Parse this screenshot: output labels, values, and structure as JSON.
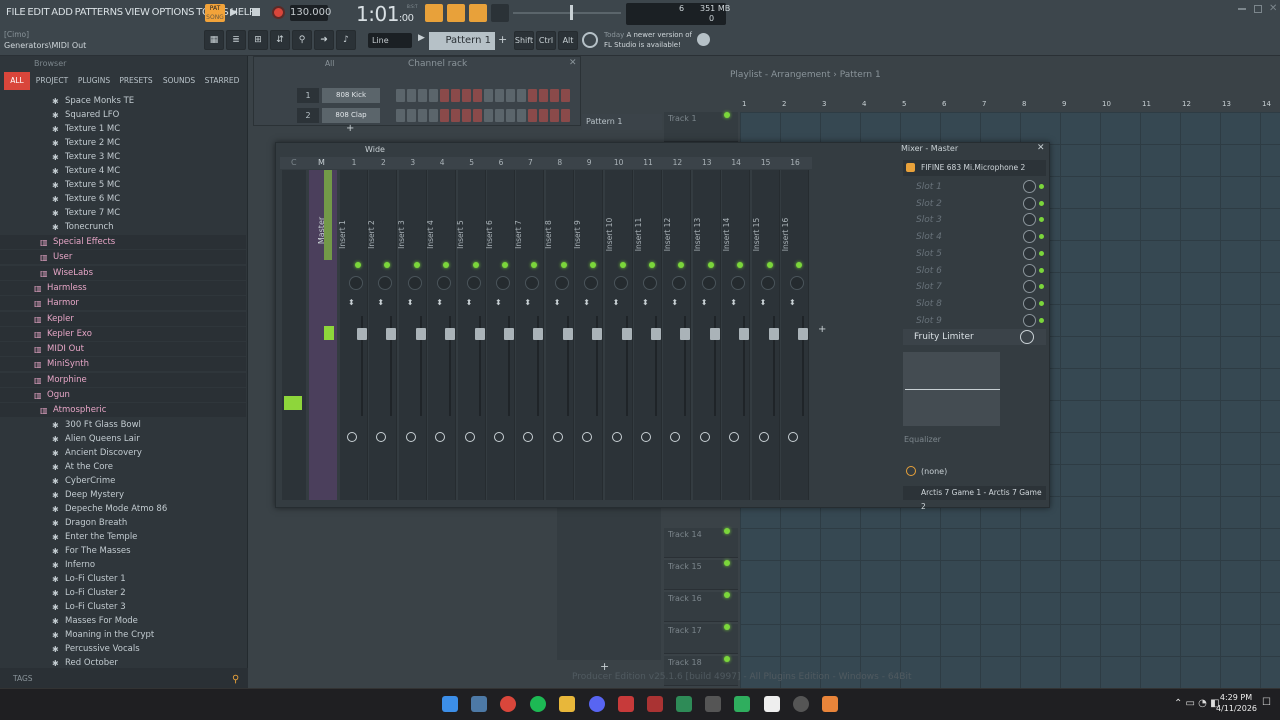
{
  "menu": [
    "FILE",
    "EDIT",
    "ADD",
    "PATTERNS",
    "VIEW",
    "OPTIONS",
    "TOOLS",
    "HELP"
  ],
  "transport": {
    "pat_label": "PAT",
    "song_label": "SONG",
    "tempo": "130.000",
    "time": "1:01",
    "time_small": ":00",
    "bst": "B:S:T"
  },
  "cpu": {
    "value": "6",
    "mem": "351 MB",
    "voices": "0"
  },
  "hint": {
    "line1": "[Cimo]",
    "line2": "Generators\\MIDI Out"
  },
  "toolbar": {
    "line": "Line",
    "pattern": "Pattern 1",
    "shift": "Shift",
    "ctrl": "Ctrl",
    "alt": "Alt"
  },
  "news": {
    "today": "Today",
    "line1": "A newer version of",
    "line2": "FL Studio is available!"
  },
  "browser": {
    "title": "Browser",
    "tabs": [
      "ALL",
      "PROJECT",
      "PLUGINS",
      "PRESETS",
      "SOUNDS",
      "STARRED"
    ],
    "items": [
      {
        "label": "Space Monks TE",
        "type": "preset"
      },
      {
        "label": "Squared LFO",
        "type": "preset"
      },
      {
        "label": "Texture 1 MC",
        "type": "preset"
      },
      {
        "label": "Texture 2 MC",
        "type": "preset"
      },
      {
        "label": "Texture 3 MC",
        "type": "preset"
      },
      {
        "label": "Texture 4 MC",
        "type": "preset"
      },
      {
        "label": "Texture 5 MC",
        "type": "preset"
      },
      {
        "label": "Texture 6 MC",
        "type": "preset"
      },
      {
        "label": "Texture 7 MC",
        "type": "preset"
      },
      {
        "label": "Tonecrunch",
        "type": "preset"
      },
      {
        "label": "Special Effects",
        "type": "folder"
      },
      {
        "label": "User",
        "type": "folder"
      },
      {
        "label": "WiseLabs",
        "type": "folder"
      },
      {
        "label": "Harmless",
        "type": "folder"
      },
      {
        "label": "Harmor",
        "type": "folder"
      },
      {
        "label": "Kepler",
        "type": "folder"
      },
      {
        "label": "Kepler Exo",
        "type": "folder"
      },
      {
        "label": "MIDI Out",
        "type": "folder"
      },
      {
        "label": "MiniSynth",
        "type": "folder"
      },
      {
        "label": "Morphine",
        "type": "folder"
      },
      {
        "label": "Ogun",
        "type": "folder"
      },
      {
        "label": "Atmospheric",
        "type": "folder"
      },
      {
        "label": "300 Ft Glass Bowl",
        "type": "preset"
      },
      {
        "label": "Alien Queens Lair",
        "type": "preset"
      },
      {
        "label": "Ancient Discovery",
        "type": "preset"
      },
      {
        "label": "At the Core",
        "type": "preset"
      },
      {
        "label": "CyberCrime",
        "type": "preset"
      },
      {
        "label": "Deep Mystery",
        "type": "preset"
      },
      {
        "label": "Depeche Mode Atmo 86",
        "type": "preset"
      },
      {
        "label": "Dragon Breath",
        "type": "preset"
      },
      {
        "label": "Enter the Temple",
        "type": "preset"
      },
      {
        "label": "For The Masses",
        "type": "preset"
      },
      {
        "label": "Inferno",
        "type": "preset"
      },
      {
        "label": "Lo-Fi Cluster 1",
        "type": "preset"
      },
      {
        "label": "Lo-Fi Cluster 2",
        "type": "preset"
      },
      {
        "label": "Lo-Fi Cluster 3",
        "type": "preset"
      },
      {
        "label": "Masses For Mode",
        "type": "preset"
      },
      {
        "label": "Moaning in the Crypt",
        "type": "preset"
      },
      {
        "label": "Percussive Vocals",
        "type": "preset"
      },
      {
        "label": "Red October",
        "type": "preset"
      }
    ],
    "tags": "TAGS"
  },
  "channel_rack": {
    "title": "Channel rack",
    "filter": "All",
    "channels": [
      {
        "num": "1",
        "name": "808 Kick"
      },
      {
        "num": "2",
        "name": "808 Clap"
      }
    ]
  },
  "playlist": {
    "title": "Playlist - Arrangement",
    "pattern": "Pattern 1",
    "pattern_item": "Pattern 1",
    "bars": [
      "1",
      "2",
      "3",
      "4",
      "5",
      "6",
      "7",
      "8",
      "9",
      "10",
      "11",
      "12",
      "13",
      "14"
    ],
    "tracks": [
      "Track 1",
      "Track 14",
      "Track 15",
      "Track 16",
      "Track 17",
      "Track 18"
    ],
    "footer": "Producer Edition v25.1.6 [build 4997] - All Plugins Edition - Windows - 64Bit"
  },
  "mixer": {
    "title": "Mixer - Master",
    "view": "Wide",
    "master_label": "Master",
    "master_col": "M",
    "current_col": "C",
    "inserts": [
      "Insert 1",
      "Insert 2",
      "Insert 3",
      "Insert 4",
      "Insert 5",
      "Insert 6",
      "Insert 7",
      "Insert 8",
      "Insert 9",
      "Insert 10",
      "Insert 11",
      "Insert 12",
      "Insert 13",
      "Insert 14",
      "Insert 15",
      "Insert 16"
    ],
    "insert_nums": [
      "1",
      "2",
      "3",
      "4",
      "5",
      "6",
      "7",
      "8",
      "9",
      "10",
      "11",
      "12",
      "13",
      "14",
      "15",
      "16"
    ],
    "input": "FIFINE 683 Mi.Microphone 2",
    "slots": [
      "Slot 1",
      "Slot 2",
      "Slot 3",
      "Slot 4",
      "Slot 5",
      "Slot 6",
      "Slot 7",
      "Slot 8",
      "Slot 9"
    ],
    "effect": "Fruity Limiter",
    "eq_label": "Equalizer",
    "none_label": "(none)",
    "output": "Arctis 7 Game 1 - Arctis 7 Game 2"
  },
  "taskbar": {
    "time": "4:29 PM",
    "date": "4/11/2026"
  }
}
